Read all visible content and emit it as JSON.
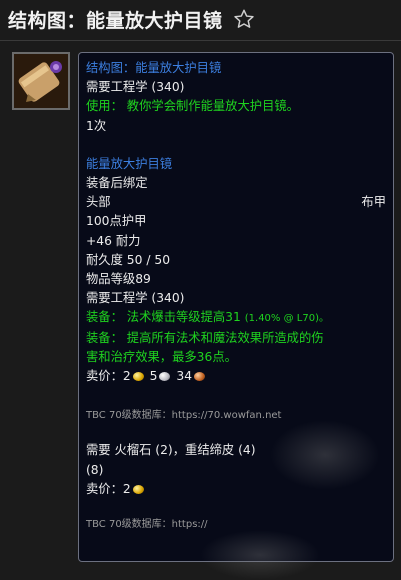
{
  "page": {
    "title": "结构图：能量放大护目镜"
  },
  "tooltip": {
    "header": "结构图：能量放大护目镜",
    "req_skill_1": "需要工程学 (340)",
    "use_line": "使用：  教你学会制作能量放大护目镜。",
    "charges": "1次",
    "item_name": "能量放大护目镜",
    "bind": "装备后绑定",
    "slot": "头部",
    "armor_type": "布甲",
    "armor": "100点护甲",
    "stat": "+46 耐力",
    "durability": "耐久度 50 / 50",
    "item_level": "物品等级89",
    "req_skill_2": "需要工程学 (340)",
    "equip1_prefix": "装备：  法术爆击等级提高31",
    "equip1_small": "(1.40% @ L70)。",
    "equip2_line1": "装备：  提高所有法术和魔法效果所造成的伤",
    "equip2_line2": "害和治疗效果，最多36点。",
    "sell_label": "卖价：",
    "sell_gold": "2",
    "sell_silver": "5",
    "sell_copper": "34",
    "source_1": "TBC 70级数据库：https://70.wowfan.net",
    "reagents_line1": "需要 火榴石 (2)，重结缔皮 (4)",
    "reagents_line2": "(8)",
    "sell2_label": "卖价：",
    "sell2_gold": "2",
    "source_2": "TBC 70级数据库：https://"
  },
  "icons": {
    "star": "star-outline-icon",
    "item": "scroll-recipe-icon"
  },
  "colors": {
    "blue": "#3c7fe0",
    "green": "#1fd31f",
    "tooltip_bg": "#070a18"
  }
}
